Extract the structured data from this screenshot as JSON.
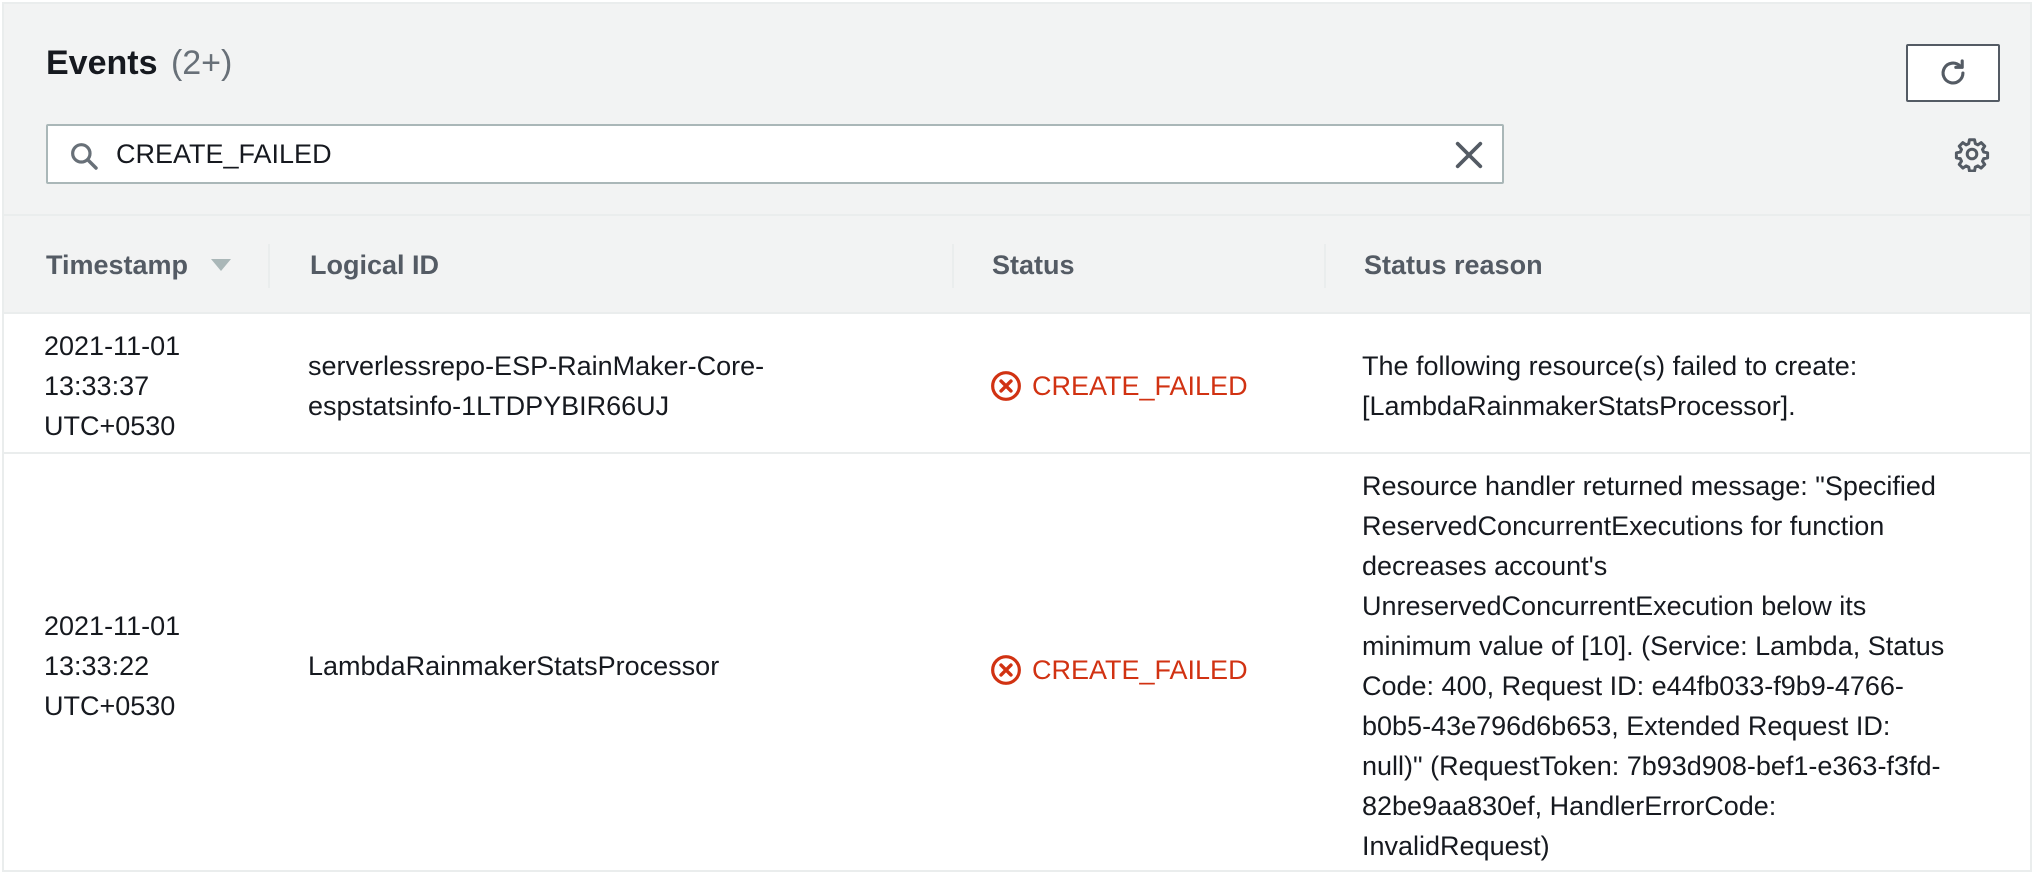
{
  "header": {
    "title": "Events",
    "count": "(2+)",
    "refresh_icon": "refresh-icon",
    "settings_icon": "gear-icon"
  },
  "search": {
    "value": "CREATE_FAILED",
    "placeholder": "",
    "icon": "search-icon",
    "clear_icon": "close-icon"
  },
  "table": {
    "columns": [
      "Timestamp",
      "Logical ID",
      "Status",
      "Status reason"
    ],
    "sort_icon": "sort-descending-icon",
    "rows": [
      {
        "timestamp": [
          "2021-11-01",
          "13:33:37",
          "UTC+0530"
        ],
        "logical_id": [
          "serverlessrepo-ESP-RainMaker-Core-",
          "espstatsinfo-1LTDPYBIR66UJ"
        ],
        "status": "CREATE_FAILED",
        "status_reason": [
          "The following resource(s) failed to create:",
          "[LambdaRainmakerStatsProcessor]."
        ]
      },
      {
        "timestamp": [
          "2021-11-01",
          "13:33:22",
          "UTC+0530"
        ],
        "logical_id": [
          "LambdaRainmakerStatsProcessor"
        ],
        "status": "CREATE_FAILED",
        "status_reason": [
          "Resource handler returned message: \"Specified",
          "ReservedConcurrentExecutions for function",
          "decreases account's",
          "UnreservedConcurrentExecution below its",
          "minimum value of [10]. (Service: Lambda, Status",
          "Code: 400, Request ID: e44fb033-f9b9-4766-",
          "b0b5-43e796d6b653, Extended Request ID:",
          "null)\" (RequestToken: 7b93d908-bef1-e363-f3fd-",
          "82be9aa830ef, HandlerErrorCode:",
          "InvalidRequest)"
        ]
      }
    ]
  },
  "colors": {
    "error": "#d13212",
    "header_bg": "#f2f3f3",
    "border": "#eaeded",
    "column_text": "#545b64"
  }
}
